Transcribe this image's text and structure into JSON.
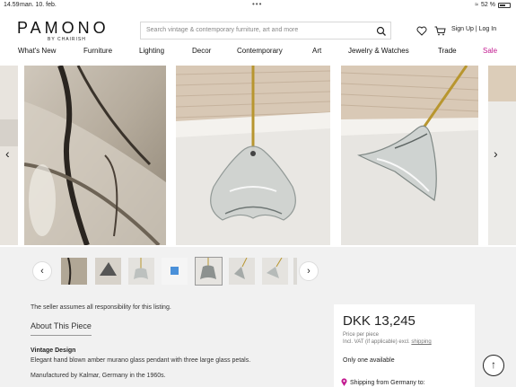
{
  "status_bar": {
    "time": "14.59",
    "date": "man. 10. feb.",
    "dots": "•••",
    "battery": "52 %"
  },
  "header": {
    "logo_text": "PAMONO",
    "logo_sub": "BY CHAIRISH",
    "search_placeholder": "Search vintage & contemporary furniture, art and more",
    "sign_up": "Sign Up",
    "separator": "|",
    "log_in": "Log In",
    "icons": [
      "heart-icon",
      "cart-icon",
      "search-icon"
    ]
  },
  "nav": [
    {
      "label": "What's New"
    },
    {
      "label": "Furniture"
    },
    {
      "label": "Lighting"
    },
    {
      "label": "Decor"
    },
    {
      "label": "Contemporary"
    },
    {
      "label": "Art"
    },
    {
      "label": "Jewelry & Watches"
    },
    {
      "label": "Trade"
    },
    {
      "label": "Sale"
    }
  ],
  "gallery": {
    "prev": "‹",
    "next": "›",
    "thumb_count": 8,
    "selected_thumb": 4
  },
  "listing": {
    "seller_note": "The seller assumes all responsibility for this listing.",
    "about_title": "About This Piece",
    "section_title": "Vintage Design",
    "description": "Elegant hand blown amber murano glass pendant with three large glass petals.",
    "manufacture": "Manufactured by Kalmar, Germany in the 1960s."
  },
  "price_card": {
    "price": "DKK 13,245",
    "price_per": "Price per piece",
    "vat_prefix": "Incl. VAT (if applicable) excl.",
    "vat_link": "shipping",
    "availability": "Only one available",
    "shipping": "Shipping from Germany to:"
  },
  "colors": {
    "sale": "#c2188f",
    "accent": "#c2188f",
    "panel": "#f1f1f1"
  }
}
